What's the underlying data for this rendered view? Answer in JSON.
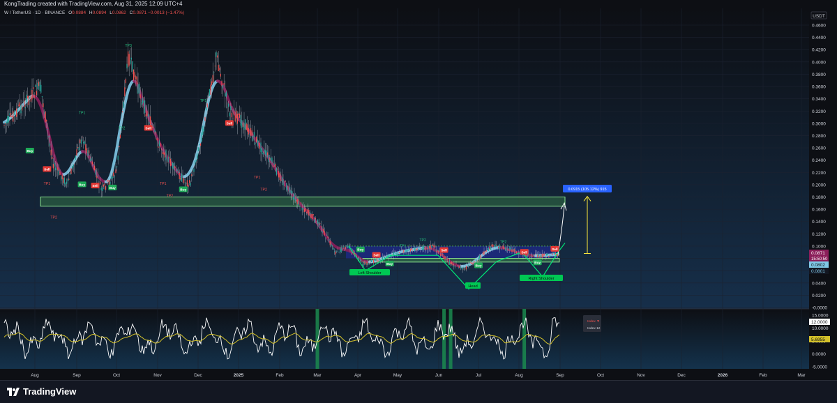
{
  "header": {
    "created_by": "KongTrading created with TradingView.com, Aug 31, 2025 12:09 UTC+4"
  },
  "legend": {
    "symbol": "W / TetherUS · 1D · BINANCE",
    "o_label": "O",
    "o_value": "0.0884",
    "h_label": "H",
    "h_value": "0.0894",
    "l_label": "L",
    "l_value": "0.0862",
    "c_label": "C",
    "c_value": "0.0871",
    "change": "−0.0013 (−1.47%)"
  },
  "colors": {
    "background": "#0d0f14",
    "up": "#26a69a",
    "down": "#ef5350",
    "pink_band": "#8b1e5a",
    "blue_band": "#7fc8e6",
    "zone_fill": "#4caf50",
    "head_shoulders": "#00e676",
    "measure_box": "#2962ff",
    "arrow": "#ffeb3b",
    "osc_line": "#ffffff",
    "osc_signal": "#d4c12a",
    "osc_highlight": "#1b8a4f"
  },
  "chart_data": {
    "type": "line",
    "title": "W / TetherUS · 1D · BINANCE",
    "price_axis": {
      "currency_label": "USDT",
      "ticks": [
        "0.4600",
        "0.4400",
        "0.4200",
        "0.4000",
        "0.3800",
        "0.3600",
        "0.3400",
        "0.3200",
        "0.3000",
        "0.2800",
        "0.2600",
        "0.2400",
        "0.2200",
        "0.2000",
        "0.1800",
        "0.1600",
        "0.1400",
        "0.1200",
        "0.1000",
        "0.0800",
        "0.0600",
        "0.0400",
        "0.0200",
        "-0.0000"
      ],
      "ylim": [
        0,
        0.47
      ]
    },
    "time_axis": {
      "labels": [
        "Aug",
        "Sep",
        "Oct",
        "Nov",
        "Dec",
        "2025",
        "Feb",
        "Mar",
        "Apr",
        "May",
        "Jun",
        "Jul",
        "Aug",
        "Sep",
        "Oct",
        "Nov",
        "Dec",
        "2026",
        "Feb",
        "Mar"
      ]
    },
    "price_series": {
      "name": "W / TetherUS",
      "x": [
        "2024-07-25",
        "2024-08-05",
        "2024-08-15",
        "2024-08-25",
        "2024-09-05",
        "2024-09-20",
        "2024-10-01",
        "2024-10-10",
        "2024-10-20",
        "2024-11-01",
        "2024-11-15",
        "2024-11-25",
        "2024-12-05",
        "2024-12-15",
        "2024-12-25",
        "2025-01-05",
        "2025-01-15",
        "2025-01-25",
        "2025-02-05",
        "2025-02-15",
        "2025-03-01",
        "2025-03-15",
        "2025-03-25",
        "2025-04-05",
        "2025-04-20",
        "2025-05-01",
        "2025-05-15",
        "2025-05-28",
        "2025-06-08",
        "2025-06-20",
        "2025-07-01",
        "2025-07-12",
        "2025-07-25",
        "2025-08-05",
        "2025-08-18",
        "2025-08-31"
      ],
      "y": [
        0.29,
        0.36,
        0.23,
        0.2,
        0.28,
        0.19,
        0.22,
        0.41,
        0.34,
        0.27,
        0.22,
        0.2,
        0.29,
        0.41,
        0.32,
        0.3,
        0.27,
        0.24,
        0.2,
        0.17,
        0.14,
        0.09,
        0.1,
        0.07,
        0.08,
        0.09,
        0.095,
        0.1,
        0.075,
        0.062,
        0.08,
        0.1,
        0.095,
        0.085,
        0.084,
        0.0871
      ]
    },
    "price_labels": {
      "last": "0.0871",
      "countdown": "15:50:50",
      "blue1": "0.0802",
      "blue2": "0.0801"
    },
    "support_zone": {
      "from": 0.165,
      "to": 0.18
    },
    "neckline": 0.1,
    "range_zone": {
      "from": 0.074,
      "to": 0.08
    },
    "measure_label": "0.0915 (105.12%) 915",
    "pattern_labels": [
      "Left Shoulder",
      "Head",
      "Right Shoulder"
    ],
    "signals": [
      {
        "text": "Buy",
        "date": "2024-07-31",
        "price": 0.255,
        "kind": "buy"
      },
      {
        "text": "Sell",
        "date": "2024-08-10",
        "price": 0.225,
        "kind": "sell"
      },
      {
        "text": "TP1",
        "date": "2024-08-10",
        "price": 0.2,
        "kind": "tp_sell"
      },
      {
        "text": "TP2",
        "date": "2024-08-15",
        "price": 0.145,
        "kind": "tp_sell"
      },
      {
        "text": "TP1",
        "date": "2024-09-05",
        "price": 0.315,
        "kind": "tp_buy"
      },
      {
        "text": "Buy",
        "date": "2024-09-05",
        "price": 0.2,
        "kind": "buy"
      },
      {
        "text": "Sell",
        "date": "2024-09-15",
        "price": 0.198,
        "kind": "sell"
      },
      {
        "text": "Buy",
        "date": "2024-09-28",
        "price": 0.195,
        "kind": "buy"
      },
      {
        "text": "TP2",
        "date": "2024-10-05",
        "price": 0.29,
        "kind": "tp_buy"
      },
      {
        "text": "TP3",
        "date": "2024-10-10",
        "price": 0.425,
        "kind": "tp_buy"
      },
      {
        "text": "Sell",
        "date": "2024-10-25",
        "price": 0.292,
        "kind": "sell"
      },
      {
        "text": "TP1",
        "date": "2024-11-05",
        "price": 0.2,
        "kind": "tp_sell"
      },
      {
        "text": "TP2",
        "date": "2024-11-10",
        "price": 0.18,
        "kind": "tp_sell"
      },
      {
        "text": "Buy",
        "date": "2024-11-20",
        "price": 0.192,
        "kind": "buy"
      },
      {
        "text": "TP1",
        "date": "2024-12-05",
        "price": 0.335,
        "kind": "tp_buy"
      },
      {
        "text": "Sell",
        "date": "2024-12-25",
        "price": 0.3,
        "kind": "sell"
      },
      {
        "text": "TP1",
        "date": "2025-01-15",
        "price": 0.21,
        "kind": "tp_sell"
      },
      {
        "text": "TP2",
        "date": "2025-01-20",
        "price": 0.19,
        "kind": "tp_sell"
      },
      {
        "text": "Buy",
        "date": "2025-04-03",
        "price": 0.094,
        "kind": "buy"
      },
      {
        "text": "Sell",
        "date": "2025-04-15",
        "price": 0.085,
        "kind": "sell"
      },
      {
        "text": "Buy",
        "date": "2025-04-25",
        "price": 0.071,
        "kind": "buy"
      },
      {
        "text": "TP1",
        "date": "2025-05-05",
        "price": 0.098,
        "kind": "tp_buy"
      },
      {
        "text": "TP2",
        "date": "2025-05-20",
        "price": 0.108,
        "kind": "tp_buy"
      },
      {
        "text": "Sell",
        "date": "2025-06-05",
        "price": 0.093,
        "kind": "sell"
      },
      {
        "text": "TP1",
        "date": "2025-06-10",
        "price": 0.07,
        "kind": "tp_sell"
      },
      {
        "text": "Buy",
        "date": "2025-07-01",
        "price": 0.068,
        "kind": "buy"
      },
      {
        "text": "TP2",
        "date": "2025-07-20",
        "price": 0.105,
        "kind": "tp_buy"
      },
      {
        "text": "Sell",
        "date": "2025-08-05",
        "price": 0.09,
        "kind": "sell"
      },
      {
        "text": "Buy",
        "date": "2025-08-15",
        "price": 0.073,
        "kind": "buy"
      },
      {
        "text": "Sell",
        "date": "2025-08-28",
        "price": 0.095,
        "kind": "sell"
      }
    ],
    "oscillator": {
      "ticks": [
        "15.0000",
        "10.0000",
        "5.0000",
        "0.0000",
        "-5.0000"
      ],
      "ylim": [
        -6.5,
        16
      ],
      "current_label": "12.0000",
      "signal_label": "5.6955",
      "menu_title": "Index ▼",
      "menu_item": "Index 12",
      "highlight_dates": [
        "2025-03-01",
        "2025-06-05",
        "2025-06-10",
        "2025-08-05"
      ]
    }
  }
}
